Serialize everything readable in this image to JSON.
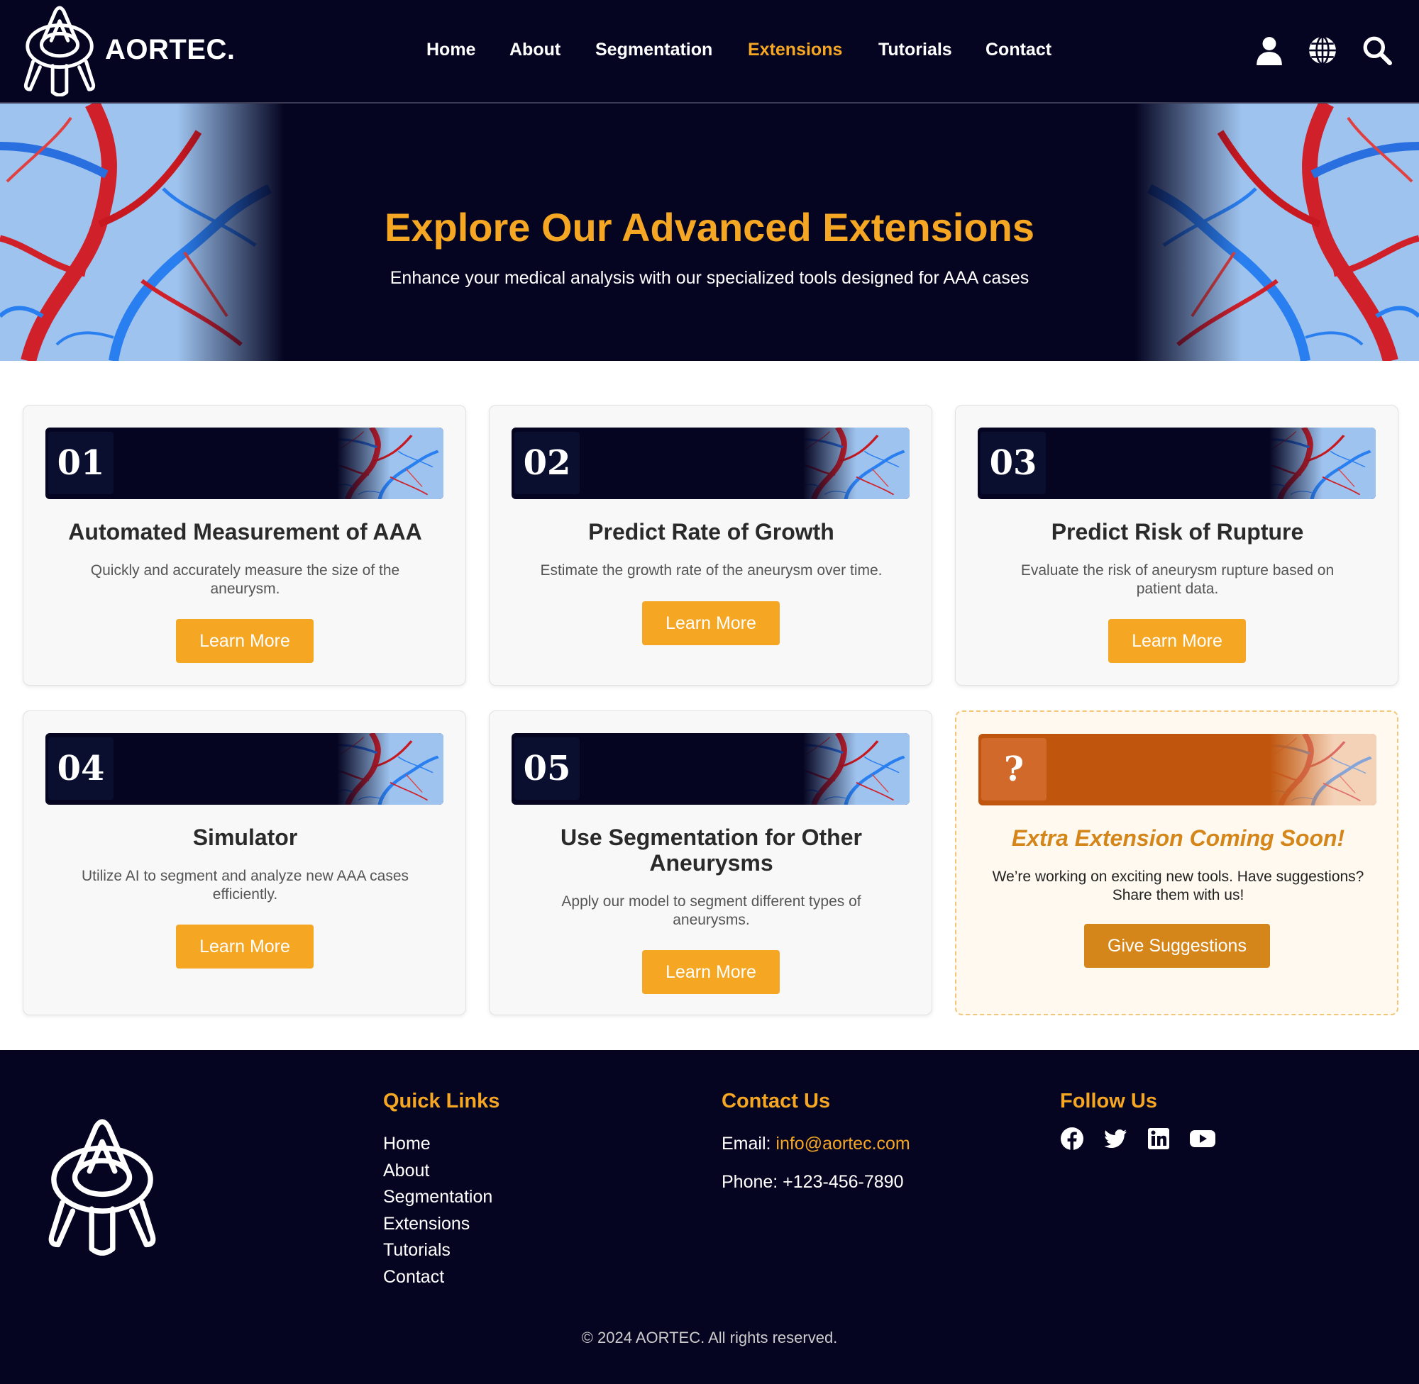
{
  "brand": {
    "name": "AORTEC."
  },
  "nav": {
    "items": [
      {
        "label": "Home"
      },
      {
        "label": "About"
      },
      {
        "label": "Segmentation"
      },
      {
        "label": "Extensions"
      },
      {
        "label": "Tutorials"
      },
      {
        "label": "Contact"
      }
    ],
    "active": "Extensions"
  },
  "header_icons": [
    "user-icon",
    "globe-icon",
    "search-icon"
  ],
  "hero": {
    "title": "Explore Our Advanced Extensions",
    "subtitle": "Enhance your medical analysis with our specialized tools designed for AAA cases"
  },
  "cards": [
    {
      "number": "01",
      "title": "Automated Measurement of AAA",
      "description": "Quickly and accurately measure the size of the aneurysm.",
      "button": "Learn More"
    },
    {
      "number": "02",
      "title": "Predict Rate of Growth",
      "description": "Estimate the growth rate of the aneurysm over time.",
      "button": "Learn More"
    },
    {
      "number": "03",
      "title": "Predict Risk of Rupture",
      "description": "Evaluate the risk of aneurysm rupture based on patient data.",
      "button": "Learn More"
    },
    {
      "number": "04",
      "title": "Simulator",
      "description": "Utilize AI to segment and analyze new AAA cases efficiently.",
      "button": "Learn More"
    },
    {
      "number": "05",
      "title": "Use Segmentation for Other Aneurysms",
      "description": "Apply our model to segment different types of aneurysms.",
      "button": "Learn More"
    },
    {
      "number": "?",
      "title": "Extra Extension Coming Soon!",
      "description": "We’re working on exciting new tools. Have suggestions? Share them with us!",
      "button": "Give Suggestions"
    }
  ],
  "footer": {
    "quick_links_title": "Quick Links",
    "quick_links": [
      {
        "label": "Home"
      },
      {
        "label": "About"
      },
      {
        "label": "Segmentation"
      },
      {
        "label": "Extensions"
      },
      {
        "label": "Tutorials"
      },
      {
        "label": "Contact"
      }
    ],
    "contact_title": "Contact Us",
    "email_label": "Email: ",
    "email": "info@aortec.com",
    "phone": "Phone: +123-456-7890",
    "follow_title": "Follow Us",
    "social": [
      "facebook-icon",
      "twitter-icon",
      "linkedin-icon",
      "youtube-icon"
    ],
    "copyright": "© 2024 AORTEC. All rights reserved."
  },
  "colors": {
    "accent": "#f5a623",
    "dark_bg": "#050522",
    "accent_dark": "#d4861a",
    "coming_soon_banner": "#c0560d"
  }
}
